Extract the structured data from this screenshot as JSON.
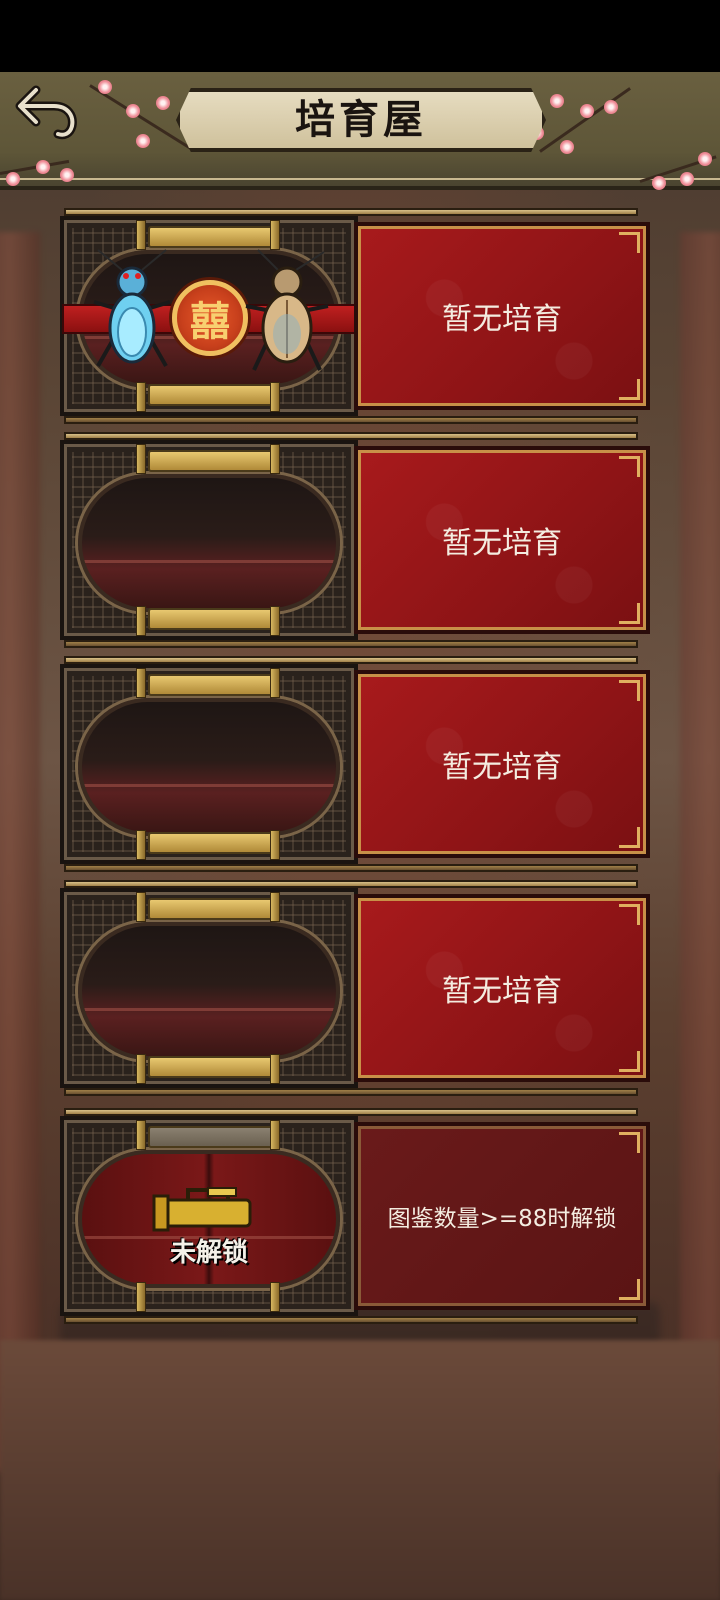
{
  "header": {
    "title": "培育屋",
    "back_icon": "back-arrow-icon"
  },
  "slots": [
    {
      "status": "暂无培育",
      "occupied": true,
      "pair_emblem": "囍"
    },
    {
      "status": "暂无培育",
      "occupied": false
    },
    {
      "status": "暂无培育",
      "occupied": false
    },
    {
      "status": "暂无培育",
      "occupied": false
    },
    {
      "status": "图鉴数量>=88时解锁",
      "locked": true,
      "lock_label": "未解锁"
    }
  ],
  "colors": {
    "panel_red": "#a81a1c",
    "gold": "#e8c870",
    "header": "#6a6040"
  }
}
